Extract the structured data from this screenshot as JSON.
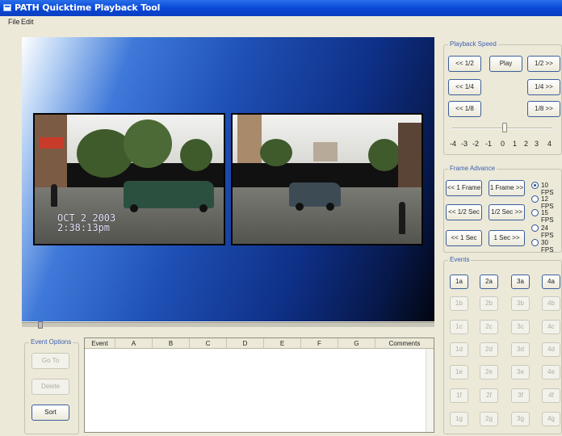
{
  "window": {
    "title": "PATH Quicktime Playback Tool"
  },
  "menu": {
    "file": "File",
    "edit": "Edit"
  },
  "video": {
    "timestamp_line1": "OCT  2 2003",
    "timestamp_line2": "2:38:13pm"
  },
  "playback": {
    "group_label": "Playback Speed",
    "buttons": [
      "<< 1/2",
      "Play",
      "1/2 >>",
      "<< 1/4",
      "1/4 >>",
      "<< 1/8",
      "1/8 >>"
    ],
    "scale": [
      "-4",
      "-3",
      "-2",
      "-1",
      "0",
      "1",
      "2",
      "3",
      "4"
    ]
  },
  "frame_advance": {
    "group_label": "Frame Advance",
    "buttons": [
      "<< 1 Frame",
      "1 Frame >>",
      "<< 1/2 Sec",
      "1/2 Sec >>",
      "<< 1 Sec",
      "1 Sec >>"
    ],
    "fps_options": [
      "10 FPS",
      "12 FPS",
      "15 FPS",
      "24 FPS",
      "30 FPS"
    ],
    "fps_selected": "10 FPS"
  },
  "events": {
    "group_label": "Events",
    "buttons": [
      "1a",
      "2a",
      "3a",
      "4a",
      "1b",
      "2b",
      "3b",
      "4b",
      "1c",
      "2c",
      "3c",
      "4c",
      "1d",
      "2d",
      "3d",
      "4d",
      "1e",
      "2e",
      "3e",
      "4e",
      "1f",
      "2f",
      "3f",
      "4f",
      "1g",
      "2g",
      "3g",
      "4g"
    ]
  },
  "event_options": {
    "group_label": "Event Options",
    "goto": "Go To",
    "delete": "Delete",
    "sort": "Sort"
  },
  "table": {
    "columns": [
      "Event",
      "A",
      "B",
      "C",
      "D",
      "E",
      "F",
      "G",
      "Comments"
    ]
  }
}
